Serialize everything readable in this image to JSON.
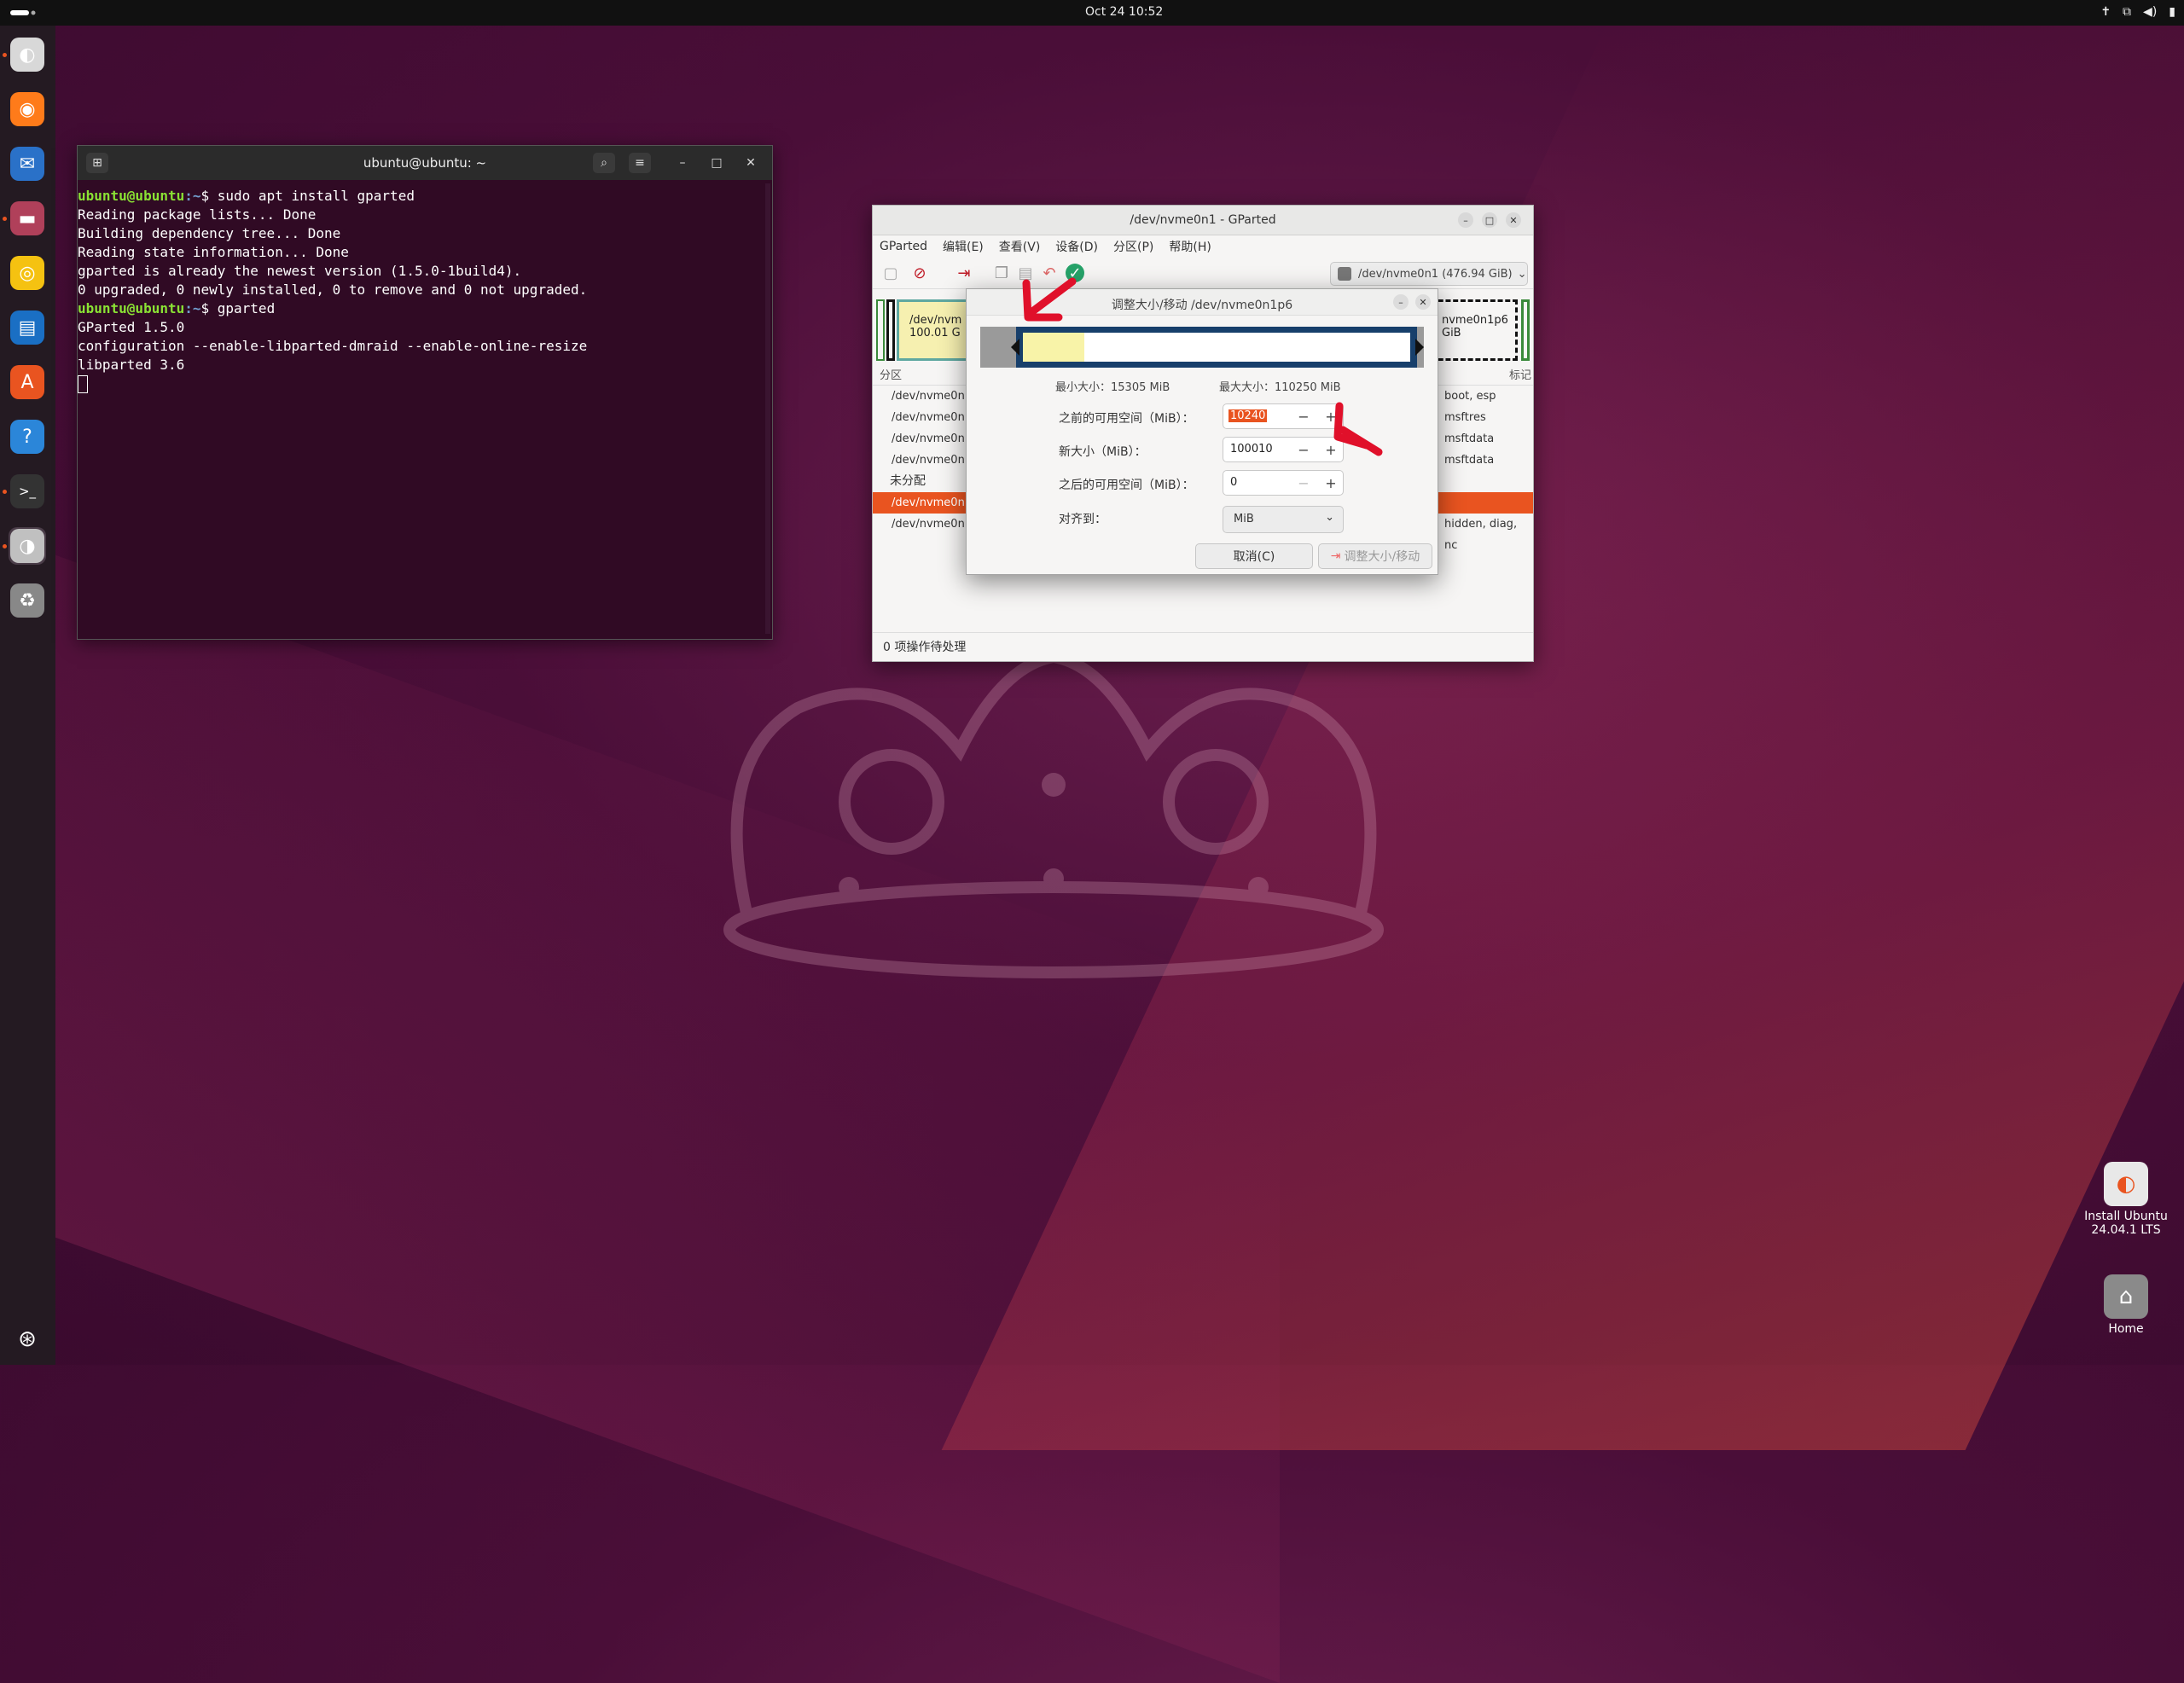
{
  "topbar": {
    "clock": "Oct 24  10:52",
    "tray_icons": [
      "accessibility-icon",
      "network-icon",
      "volume-icon",
      "battery-icon"
    ]
  },
  "dock": {
    "items": [
      {
        "name": "installer",
        "glyph": "◐",
        "bg": "#d8d8d8"
      },
      {
        "name": "firefox",
        "glyph": "◉",
        "bg": "#ff7b1a"
      },
      {
        "name": "thunderbird",
        "glyph": "✉",
        "bg": "#2a71c8"
      },
      {
        "name": "files",
        "glyph": "▬",
        "bg": "#b0405a"
      },
      {
        "name": "rhythmbox",
        "glyph": "◎",
        "bg": "#f5c211"
      },
      {
        "name": "writer",
        "glyph": "▤",
        "bg": "#1a6fc4"
      },
      {
        "name": "app-center",
        "glyph": "A",
        "bg": "#e95420"
      },
      {
        "name": "help",
        "glyph": "?",
        "bg": "#2b86d9"
      },
      {
        "name": "terminal",
        "glyph": ">_",
        "bg": "#333333"
      },
      {
        "name": "gparted",
        "glyph": "◑",
        "bg": "#c0c0c0"
      },
      {
        "name": "trash",
        "glyph": "♻",
        "bg": "#888888"
      }
    ]
  },
  "terminal": {
    "title": "ubuntu@ubuntu: ~",
    "prompt_user": "ubuntu@ubuntu",
    "prompt_path": ":~",
    "prompt_sign": "$ ",
    "cmd1": "sudo apt install gparted",
    "out1": "Reading package lists... Done",
    "out2": "Building dependency tree... Done",
    "out3": "Reading state information... Done",
    "out4": "gparted is already the newest version (1.5.0-1build4).",
    "out5": "0 upgraded, 0 newly installed, 0 to remove and 0 not upgraded.",
    "cmd2": "gparted",
    "out6": "GParted 1.5.0",
    "out7": "configuration --enable-libparted-dmraid --enable-online-resize",
    "out8": "libparted 3.6"
  },
  "gparted": {
    "title": "/dev/nvme0n1 - GParted",
    "menu": [
      "GParted",
      "编辑(E)",
      "查看(V)",
      "设备(D)",
      "分区(P)",
      "帮助(H)"
    ],
    "device": "/dev/nvme0n1 (476.94 GiB)",
    "map_part_a": "/dev/nvm",
    "map_part_a_size": "100.01 G",
    "map_part_b": "nvme0n1p6",
    "map_part_b_size": "GiB",
    "col_partition": "分区",
    "col_label": "标记",
    "rows": [
      {
        "name": "/dev/nvme0n",
        "flags": "boot, esp",
        "selected": false
      },
      {
        "name": "/dev/nvme0n",
        "flags": "msftres",
        "selected": false
      },
      {
        "name": "/dev/nvme0n",
        "flags": "msftdata",
        "selected": false
      },
      {
        "name": "/dev/nvme0n",
        "flags": "msftdata",
        "selected": false
      },
      {
        "name": "未分配",
        "flags": "",
        "selected": false
      },
      {
        "name": "/dev/nvme0n",
        "flags": "",
        "selected": true
      },
      {
        "name": "/dev/nvme0n",
        "flags": "hidden, diag, nc",
        "selected": false
      }
    ],
    "status": "0 项操作待处理"
  },
  "dialog": {
    "title": "调整大小/移动 /dev/nvme0n1p6",
    "min_label": "最小大小：",
    "min_value": "15305 MiB",
    "max_label": "最大大小：",
    "max_value": "110250 MiB",
    "before_label": "之前的可用空间（MiB）：",
    "before_value": "10240",
    "size_label": "新大小（MiB）：",
    "size_value": "100010",
    "after_label": "之后的可用空间（MiB）：",
    "after_value": "0",
    "align_label": "对齐到：",
    "align_value": "MiB",
    "cancel": "取消(C)",
    "ok": "调整大小/移动"
  },
  "desktop": {
    "install_line1": "Install Ubuntu",
    "install_line2": "24.04.1 LTS",
    "home": "Home"
  },
  "colors": {
    "accent": "#e95420",
    "annotation": "#e0102a"
  }
}
